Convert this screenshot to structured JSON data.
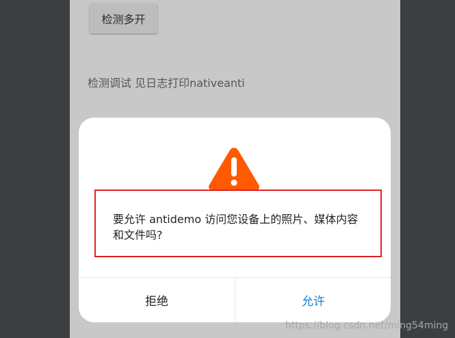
{
  "app": {
    "detect_multi_button": "检测多开",
    "debug_text": "检测调试  见日志打印nativeanti"
  },
  "dialog": {
    "icon": "warning-triangle-icon",
    "icon_color": "#ff5a00",
    "message": "要允许 antidemo 访问您设备上的照片、媒体内容和文件吗?",
    "deny_label": "拒绝",
    "allow_label": "允许",
    "allow_color": "#0a84d8",
    "highlight_color": "#e02020"
  },
  "watermark": "https://blog.csdn.net/ming54ming"
}
